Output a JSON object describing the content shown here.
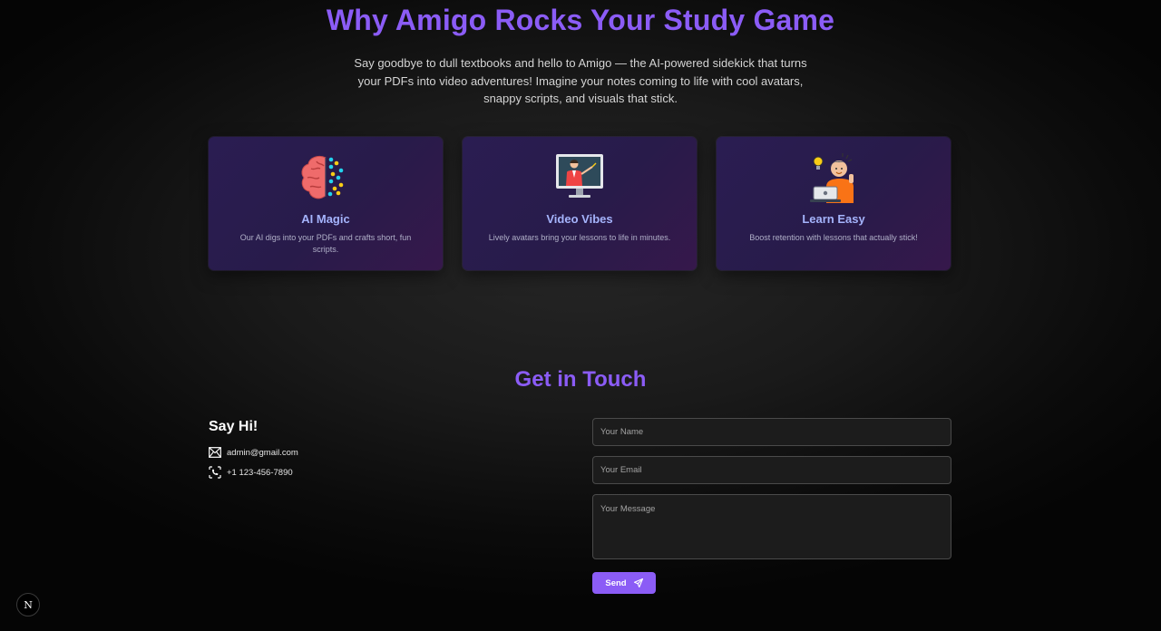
{
  "hero": {
    "title": "Why Amigo Rocks Your Study Game",
    "description": "Say goodbye to dull textbooks and hello to Amigo — the AI-powered sidekick that turns your PDFs into video adventures! Imagine your notes coming to life with cool avatars, snappy scripts, and visuals that stick."
  },
  "features": [
    {
      "icon": "brain-icon",
      "title": "AI Magic",
      "description": "Our AI digs into your PDFs and crafts short, fun scripts."
    },
    {
      "icon": "teacher-screen-icon",
      "title": "Video Vibes",
      "description": "Lively avatars bring your lessons to life in minutes."
    },
    {
      "icon": "student-laptop-icon",
      "title": "Learn Easy",
      "description": "Boost retention with lessons that actually stick!"
    }
  ],
  "contact": {
    "title": "Get in Touch",
    "say_hi": "Say Hi!",
    "email": "admin@gmail.com",
    "phone": "+1 123-456-7890",
    "form": {
      "name_placeholder": "Your Name",
      "email_placeholder": "Your Email",
      "message_placeholder": "Your Message",
      "send_label": "Send"
    }
  },
  "badge": {
    "label": "N"
  },
  "colors": {
    "accent": "#8b5cf6",
    "card_title": "#a5b4fc",
    "background": "#1a1a1a"
  }
}
